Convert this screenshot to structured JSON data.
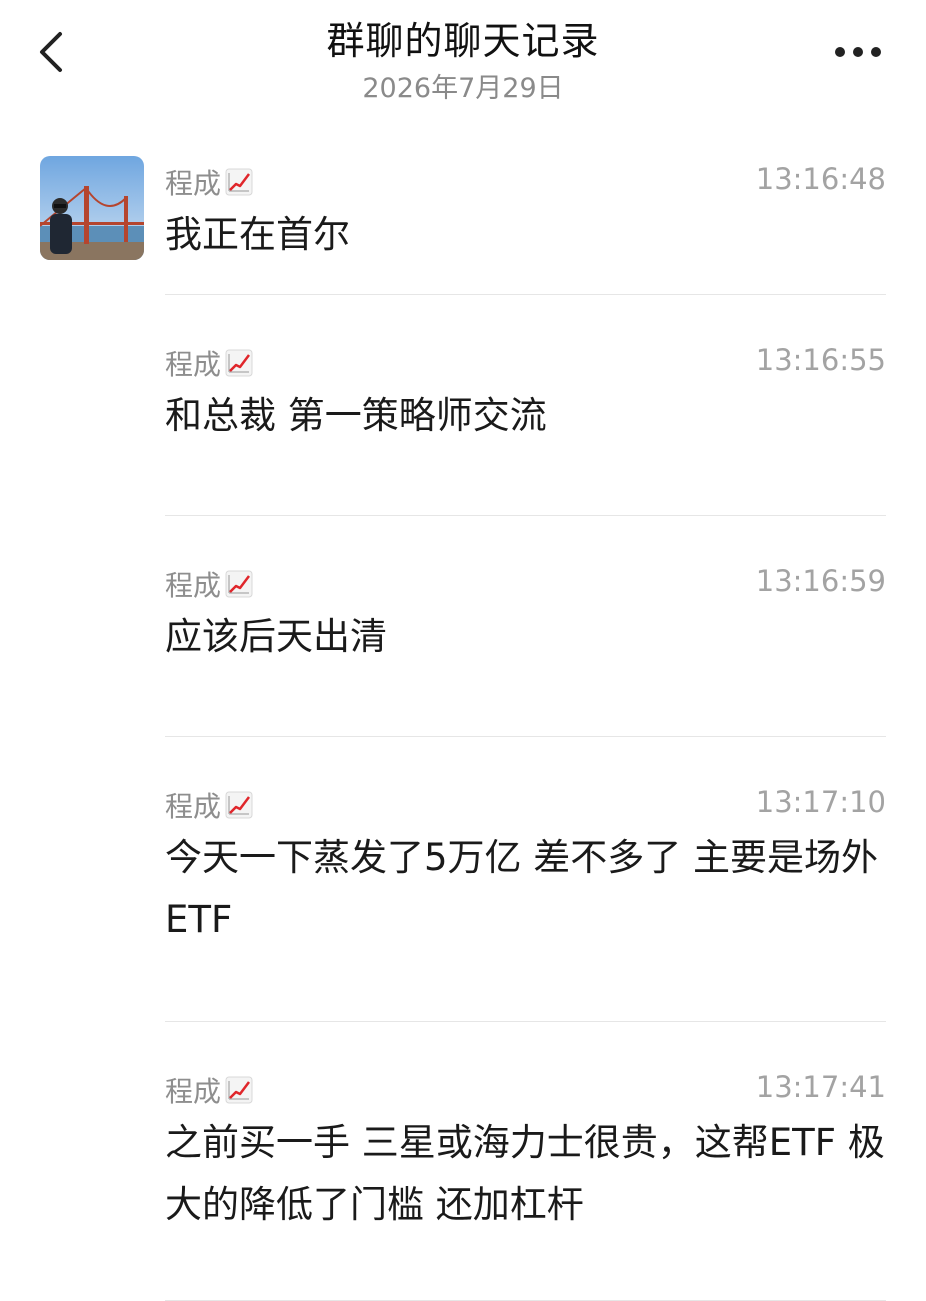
{
  "header": {
    "title": "群聊的聊天记录",
    "date": "2026年7月29日"
  },
  "messages": [
    {
      "sender": "程成",
      "time": "13:16:48",
      "text": "我正在首尔"
    },
    {
      "sender": "程成",
      "time": "13:16:55",
      "text": "和总裁 第一策略师交流"
    },
    {
      "sender": "程成",
      "time": "13:16:59",
      "text": "应该后天出清"
    },
    {
      "sender": "程成",
      "time": "13:17:10",
      "text": "今天一下蒸发了5万亿 差不多了 主要是场外ETF"
    },
    {
      "sender": "程成",
      "time": "13:17:41",
      "text": "之前买一手 三星或海力士很贵，这帮ETF 极大的降低了门槛 还加杠杆"
    }
  ],
  "icons": {
    "back": "chevron-left-icon",
    "more": "more-dots-icon",
    "sender_badge": "chart-increasing-icon"
  },
  "colors": {
    "title": "#111111",
    "meta": "#8e8e8e",
    "divider": "#e6e6e6"
  }
}
